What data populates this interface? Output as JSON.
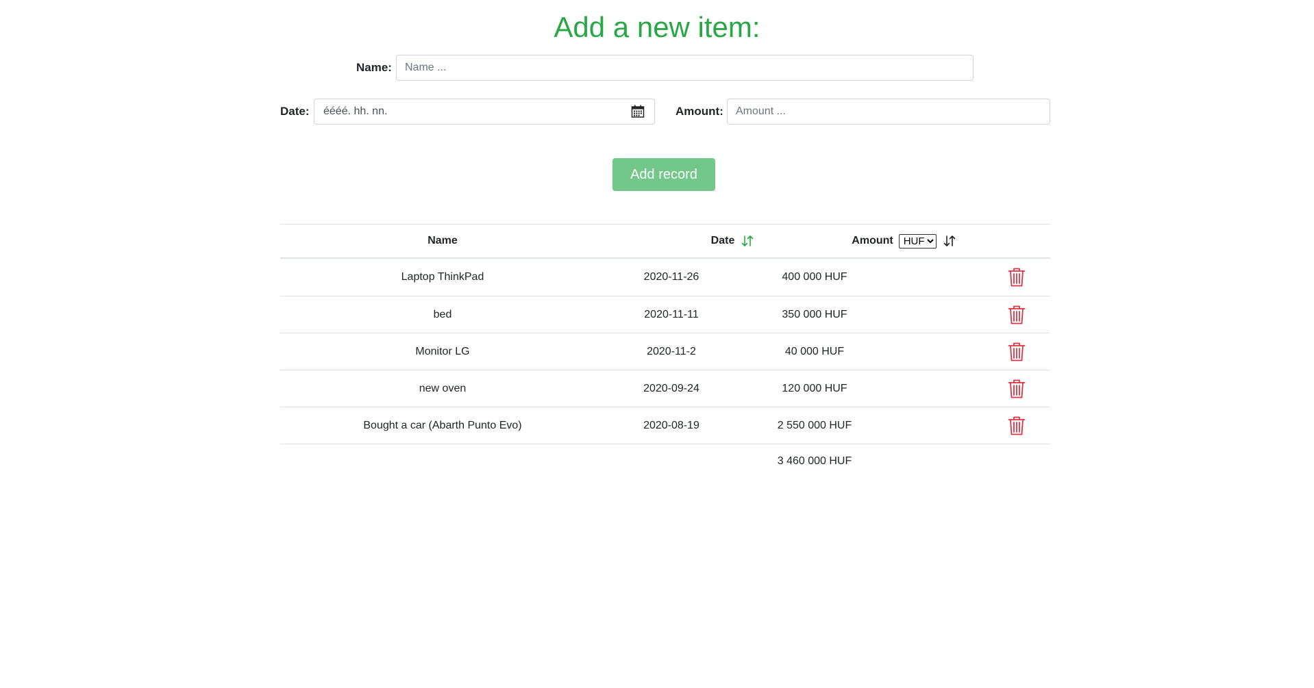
{
  "form": {
    "title": "Add a new item:",
    "name_label": "Name:",
    "name_placeholder": "Name ...",
    "date_label": "Date:",
    "date_value": "éééé. hh. nn.",
    "amount_label": "Amount:",
    "amount_placeholder": "Amount ...",
    "add_button": "Add record"
  },
  "table": {
    "headers": {
      "name": "Name",
      "date": "Date",
      "amount": "Amount",
      "currency": "HUF"
    },
    "currency_options": [
      "HUF"
    ],
    "rows": [
      {
        "name": "Laptop ThinkPad",
        "date": "2020-11-26",
        "amount": "400 000 HUF"
      },
      {
        "name": "bed",
        "date": "2020-11-11",
        "amount": "350 000 HUF"
      },
      {
        "name": "Monitor LG",
        "date": "2020-11-2",
        "amount": "40 000 HUF"
      },
      {
        "name": "new oven",
        "date": "2020-09-24",
        "amount": "120 000 HUF"
      },
      {
        "name": "Bought a car (Abarth Punto Evo)",
        "date": "2020-08-19",
        "amount": "2 550 000 HUF"
      }
    ],
    "total": "3 460 000 HUF"
  },
  "colors": {
    "accent_green": "#28a745",
    "button_green": "#73c78a",
    "delete_red": "#dc3545",
    "border": "#dee2e6"
  },
  "icons": {
    "date_sort": "sort-arrows-icon",
    "amount_sort": "sort-arrows-icon",
    "calendar": "calendar-icon",
    "delete": "trash-icon"
  }
}
